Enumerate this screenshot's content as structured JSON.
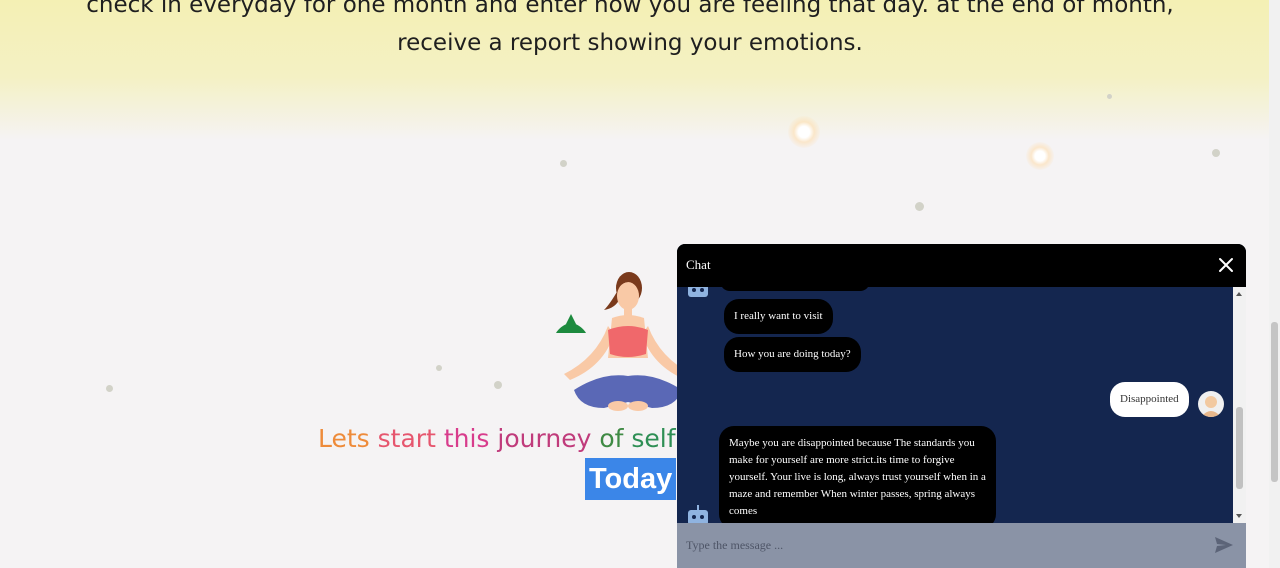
{
  "hero": {
    "line1": "check in everyday for one month and enter how you are feeling that day. at the end of month,",
    "line2": "receive a report showing your emotions."
  },
  "journey": {
    "words": [
      "Lets",
      "start",
      "this",
      "journey",
      "of",
      "self de"
    ],
    "button": "Today"
  },
  "chat": {
    "title": "Chat",
    "close_icon": "close-icon",
    "messages": [
      {
        "from": "bot",
        "text": "I really want to visit"
      },
      {
        "from": "bot",
        "text": "How you are doing today?"
      },
      {
        "from": "user",
        "text": "Disappointed"
      },
      {
        "from": "bot",
        "text": "Maybe you are disappointed because The standards you make for yourself are more strict.its time to forgive yourself. Your live is long, always trust yourself when in a maze and remember When winter passes, spring always comes"
      }
    ],
    "input_placeholder": "Type the message ...",
    "send_icon": "send-icon"
  },
  "colors": {
    "chat_bg": "#14264f",
    "header_bg": "#000000",
    "highlight": "#3b86e8"
  }
}
